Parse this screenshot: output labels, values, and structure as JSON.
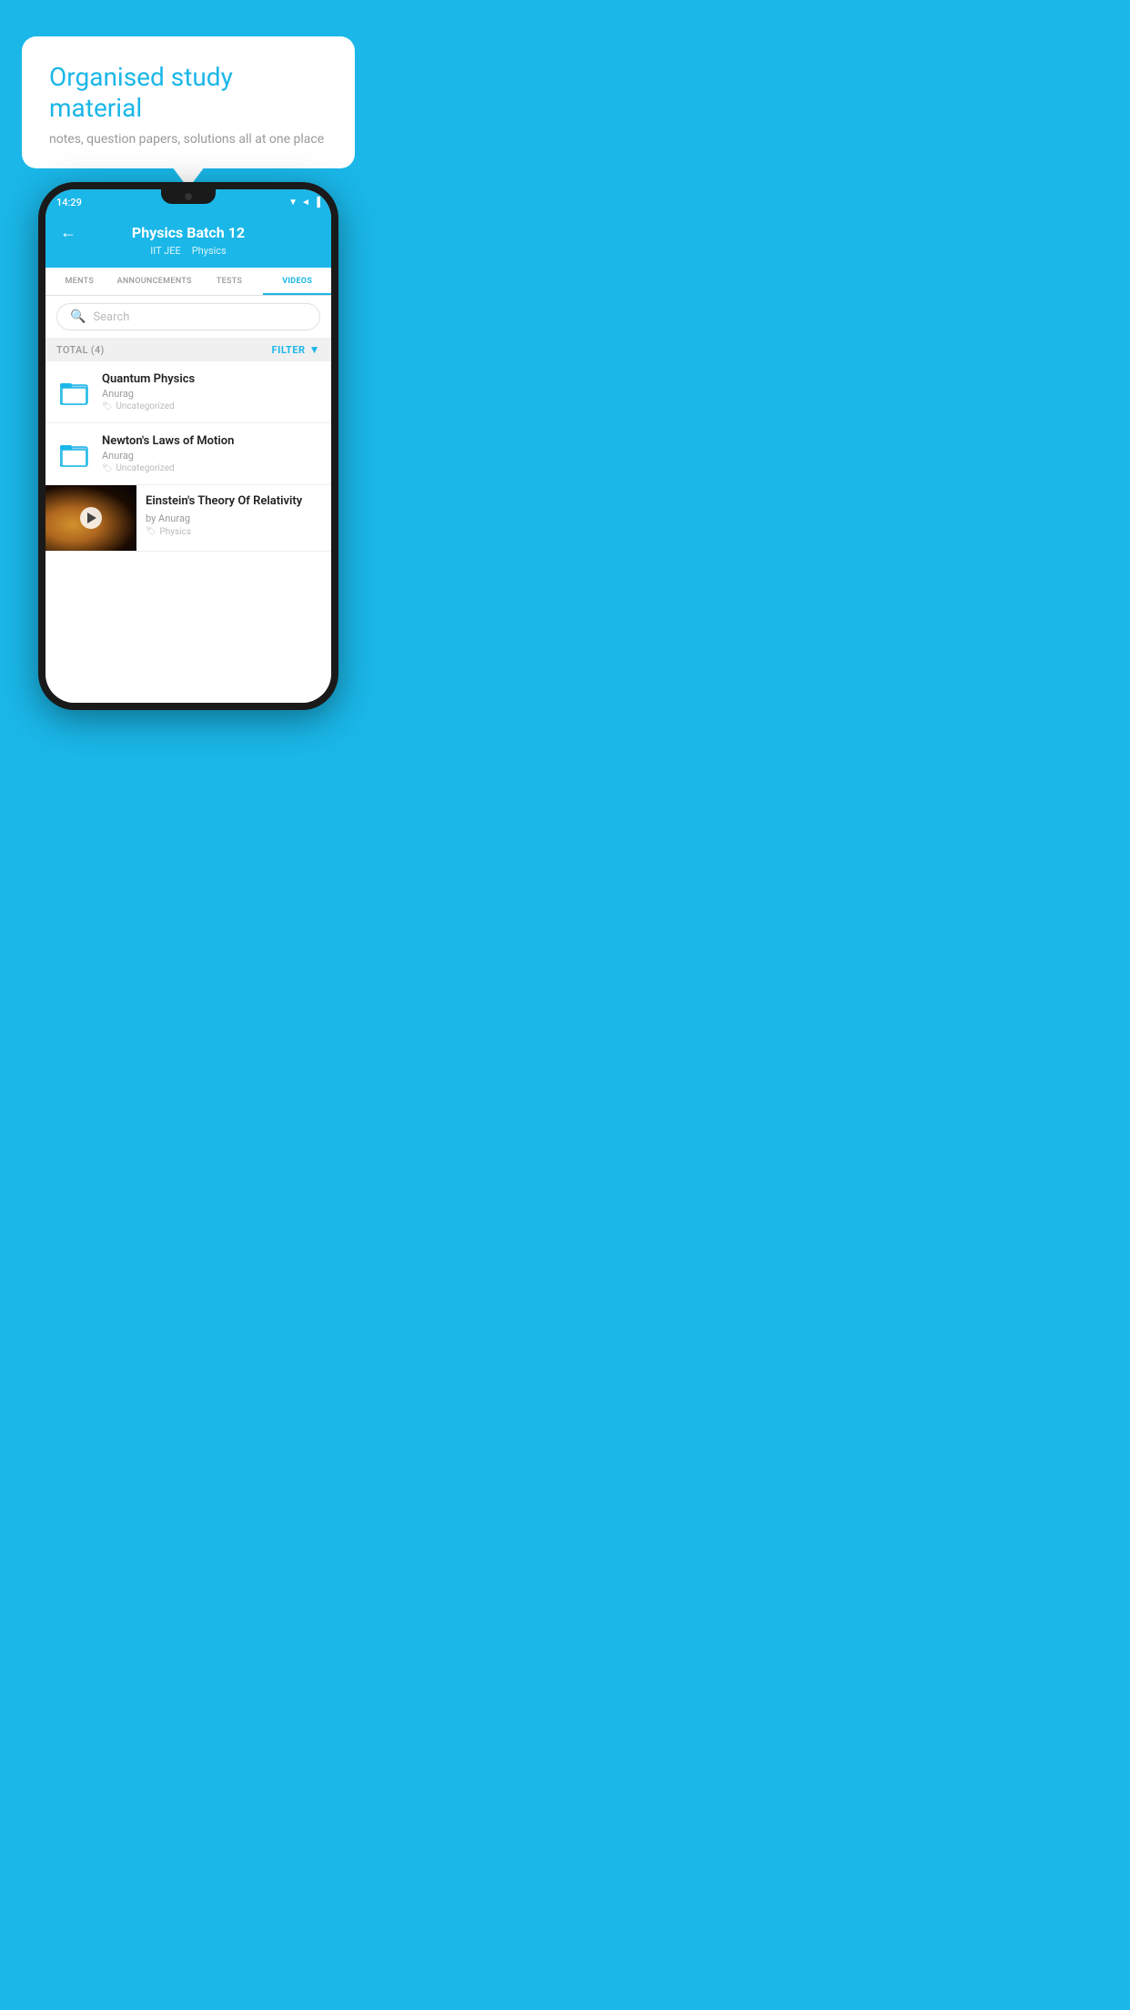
{
  "background_color": "#1ab7e8",
  "speech_bubble": {
    "heading": "Organised study material",
    "subtext": "notes, question papers, solutions all at one place"
  },
  "phone": {
    "status_bar": {
      "time": "14:29",
      "icons": "▼◄▐"
    },
    "header": {
      "back_label": "←",
      "title": "Physics Batch 12",
      "subtitle_1": "IIT JEE",
      "subtitle_2": "Physics"
    },
    "tabs": [
      {
        "label": "MENTS",
        "active": false
      },
      {
        "label": "ANNOUNCEMENTS",
        "active": false
      },
      {
        "label": "TESTS",
        "active": false
      },
      {
        "label": "VIDEOS",
        "active": true
      }
    ],
    "search": {
      "placeholder": "Search"
    },
    "filter_bar": {
      "total_label": "TOTAL (4)",
      "filter_label": "FILTER"
    },
    "videos": [
      {
        "id": 1,
        "title": "Quantum Physics",
        "author": "Anurag",
        "tag": "Uncategorized",
        "has_thumbnail": false
      },
      {
        "id": 2,
        "title": "Newton's Laws of Motion",
        "author": "Anurag",
        "tag": "Uncategorized",
        "has_thumbnail": false
      },
      {
        "id": 3,
        "title": "Einstein's Theory Of Relativity",
        "author": "by Anurag",
        "tag": "Physics",
        "has_thumbnail": true
      }
    ]
  }
}
